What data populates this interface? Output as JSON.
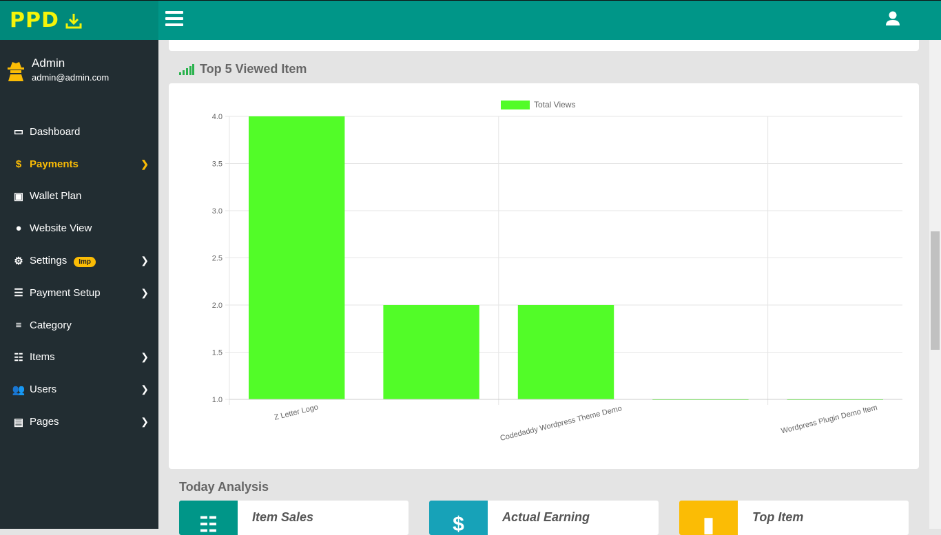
{
  "brand": {
    "logo_text": "PPD"
  },
  "user": {
    "name": "Admin",
    "email": "admin@admin.com"
  },
  "sidebar": {
    "items": [
      {
        "label": "Dashboard",
        "icon": "laptop-icon"
      },
      {
        "label": "Payments",
        "icon": "dollar-icon",
        "active": true,
        "chevron": true
      },
      {
        "label": "Wallet Plan",
        "icon": "money-icon"
      },
      {
        "label": "Website View",
        "icon": "globe-icon"
      },
      {
        "label": "Settings",
        "icon": "gear-icon",
        "badge": "Imp",
        "chevron": true
      },
      {
        "label": "Payment Setup",
        "icon": "sliders-icon",
        "chevron": true
      },
      {
        "label": "Category",
        "icon": "align-left-icon"
      },
      {
        "label": "Items",
        "icon": "list-ol-icon",
        "chevron": true
      },
      {
        "label": "Users",
        "icon": "users-icon",
        "chevron": true
      },
      {
        "label": "Pages",
        "icon": "file-icon",
        "chevron": true
      }
    ]
  },
  "section1": {
    "title": "Top 5 Viewed Item"
  },
  "chart_data": {
    "type": "bar",
    "title": "",
    "legend": [
      "Total Views"
    ],
    "legend_position": "top",
    "categories": [
      "Z Letter Logo",
      "",
      "Codedaddy Wordpress Theme Demo",
      "",
      "Wordpress Plugin Demo Item"
    ],
    "values": [
      4,
      2,
      2,
      1,
      1
    ],
    "ylim": [
      1,
      4
    ],
    "yticks": [
      "1.0",
      "1.5",
      "2.0",
      "2.5",
      "3.0",
      "3.5",
      "4.0"
    ],
    "color": "#52fc28",
    "grid": true
  },
  "section2": {
    "title": "Today Analysis"
  },
  "stats": [
    {
      "label": "Item Sales",
      "color": "#009688",
      "icon": "list-ol-icon"
    },
    {
      "label": "Actual Earning",
      "color": "#17a2b8",
      "icon": "dollar-icon"
    },
    {
      "label": "Top Item",
      "color": "#fbbc05",
      "icon": "bar-chart-icon"
    }
  ]
}
